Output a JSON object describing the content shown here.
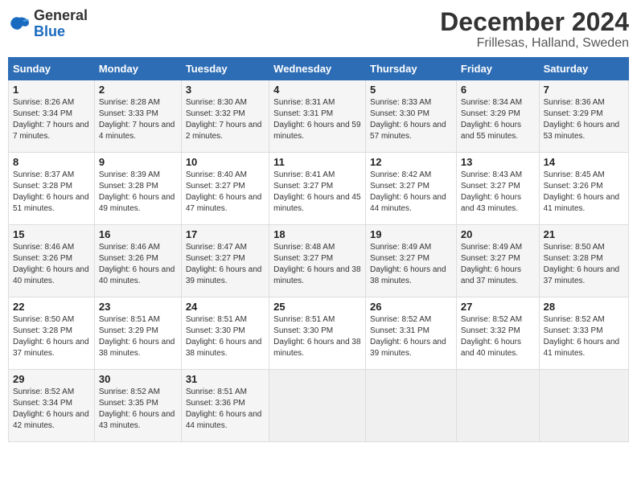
{
  "header": {
    "logo_line1": "General",
    "logo_line2": "Blue",
    "month": "December 2024",
    "location": "Frillesas, Halland, Sweden"
  },
  "days_of_week": [
    "Sunday",
    "Monday",
    "Tuesday",
    "Wednesday",
    "Thursday",
    "Friday",
    "Saturday"
  ],
  "weeks": [
    [
      {
        "day": "1",
        "sunrise": "8:26 AM",
        "sunset": "3:34 PM",
        "daylight": "7 hours and 7 minutes."
      },
      {
        "day": "2",
        "sunrise": "8:28 AM",
        "sunset": "3:33 PM",
        "daylight": "7 hours and 4 minutes."
      },
      {
        "day": "3",
        "sunrise": "8:30 AM",
        "sunset": "3:32 PM",
        "daylight": "7 hours and 2 minutes."
      },
      {
        "day": "4",
        "sunrise": "8:31 AM",
        "sunset": "3:31 PM",
        "daylight": "6 hours and 59 minutes."
      },
      {
        "day": "5",
        "sunrise": "8:33 AM",
        "sunset": "3:30 PM",
        "daylight": "6 hours and 57 minutes."
      },
      {
        "day": "6",
        "sunrise": "8:34 AM",
        "sunset": "3:29 PM",
        "daylight": "6 hours and 55 minutes."
      },
      {
        "day": "7",
        "sunrise": "8:36 AM",
        "sunset": "3:29 PM",
        "daylight": "6 hours and 53 minutes."
      }
    ],
    [
      {
        "day": "8",
        "sunrise": "8:37 AM",
        "sunset": "3:28 PM",
        "daylight": "6 hours and 51 minutes."
      },
      {
        "day": "9",
        "sunrise": "8:39 AM",
        "sunset": "3:28 PM",
        "daylight": "6 hours and 49 minutes."
      },
      {
        "day": "10",
        "sunrise": "8:40 AM",
        "sunset": "3:27 PM",
        "daylight": "6 hours and 47 minutes."
      },
      {
        "day": "11",
        "sunrise": "8:41 AM",
        "sunset": "3:27 PM",
        "daylight": "6 hours and 45 minutes."
      },
      {
        "day": "12",
        "sunrise": "8:42 AM",
        "sunset": "3:27 PM",
        "daylight": "6 hours and 44 minutes."
      },
      {
        "day": "13",
        "sunrise": "8:43 AM",
        "sunset": "3:27 PM",
        "daylight": "6 hours and 43 minutes."
      },
      {
        "day": "14",
        "sunrise": "8:45 AM",
        "sunset": "3:26 PM",
        "daylight": "6 hours and 41 minutes."
      }
    ],
    [
      {
        "day": "15",
        "sunrise": "8:46 AM",
        "sunset": "3:26 PM",
        "daylight": "6 hours and 40 minutes."
      },
      {
        "day": "16",
        "sunrise": "8:46 AM",
        "sunset": "3:26 PM",
        "daylight": "6 hours and 40 minutes."
      },
      {
        "day": "17",
        "sunrise": "8:47 AM",
        "sunset": "3:27 PM",
        "daylight": "6 hours and 39 minutes."
      },
      {
        "day": "18",
        "sunrise": "8:48 AM",
        "sunset": "3:27 PM",
        "daylight": "6 hours and 38 minutes."
      },
      {
        "day": "19",
        "sunrise": "8:49 AM",
        "sunset": "3:27 PM",
        "daylight": "6 hours and 38 minutes."
      },
      {
        "day": "20",
        "sunrise": "8:49 AM",
        "sunset": "3:27 PM",
        "daylight": "6 hours and 37 minutes."
      },
      {
        "day": "21",
        "sunrise": "8:50 AM",
        "sunset": "3:28 PM",
        "daylight": "6 hours and 37 minutes."
      }
    ],
    [
      {
        "day": "22",
        "sunrise": "8:50 AM",
        "sunset": "3:28 PM",
        "daylight": "6 hours and 37 minutes."
      },
      {
        "day": "23",
        "sunrise": "8:51 AM",
        "sunset": "3:29 PM",
        "daylight": "6 hours and 38 minutes."
      },
      {
        "day": "24",
        "sunrise": "8:51 AM",
        "sunset": "3:30 PM",
        "daylight": "6 hours and 38 minutes."
      },
      {
        "day": "25",
        "sunrise": "8:51 AM",
        "sunset": "3:30 PM",
        "daylight": "6 hours and 38 minutes."
      },
      {
        "day": "26",
        "sunrise": "8:52 AM",
        "sunset": "3:31 PM",
        "daylight": "6 hours and 39 minutes."
      },
      {
        "day": "27",
        "sunrise": "8:52 AM",
        "sunset": "3:32 PM",
        "daylight": "6 hours and 40 minutes."
      },
      {
        "day": "28",
        "sunrise": "8:52 AM",
        "sunset": "3:33 PM",
        "daylight": "6 hours and 41 minutes."
      }
    ],
    [
      {
        "day": "29",
        "sunrise": "8:52 AM",
        "sunset": "3:34 PM",
        "daylight": "6 hours and 42 minutes."
      },
      {
        "day": "30",
        "sunrise": "8:52 AM",
        "sunset": "3:35 PM",
        "daylight": "6 hours and 43 minutes."
      },
      {
        "day": "31",
        "sunrise": "8:51 AM",
        "sunset": "3:36 PM",
        "daylight": "6 hours and 44 minutes."
      },
      null,
      null,
      null,
      null
    ]
  ]
}
